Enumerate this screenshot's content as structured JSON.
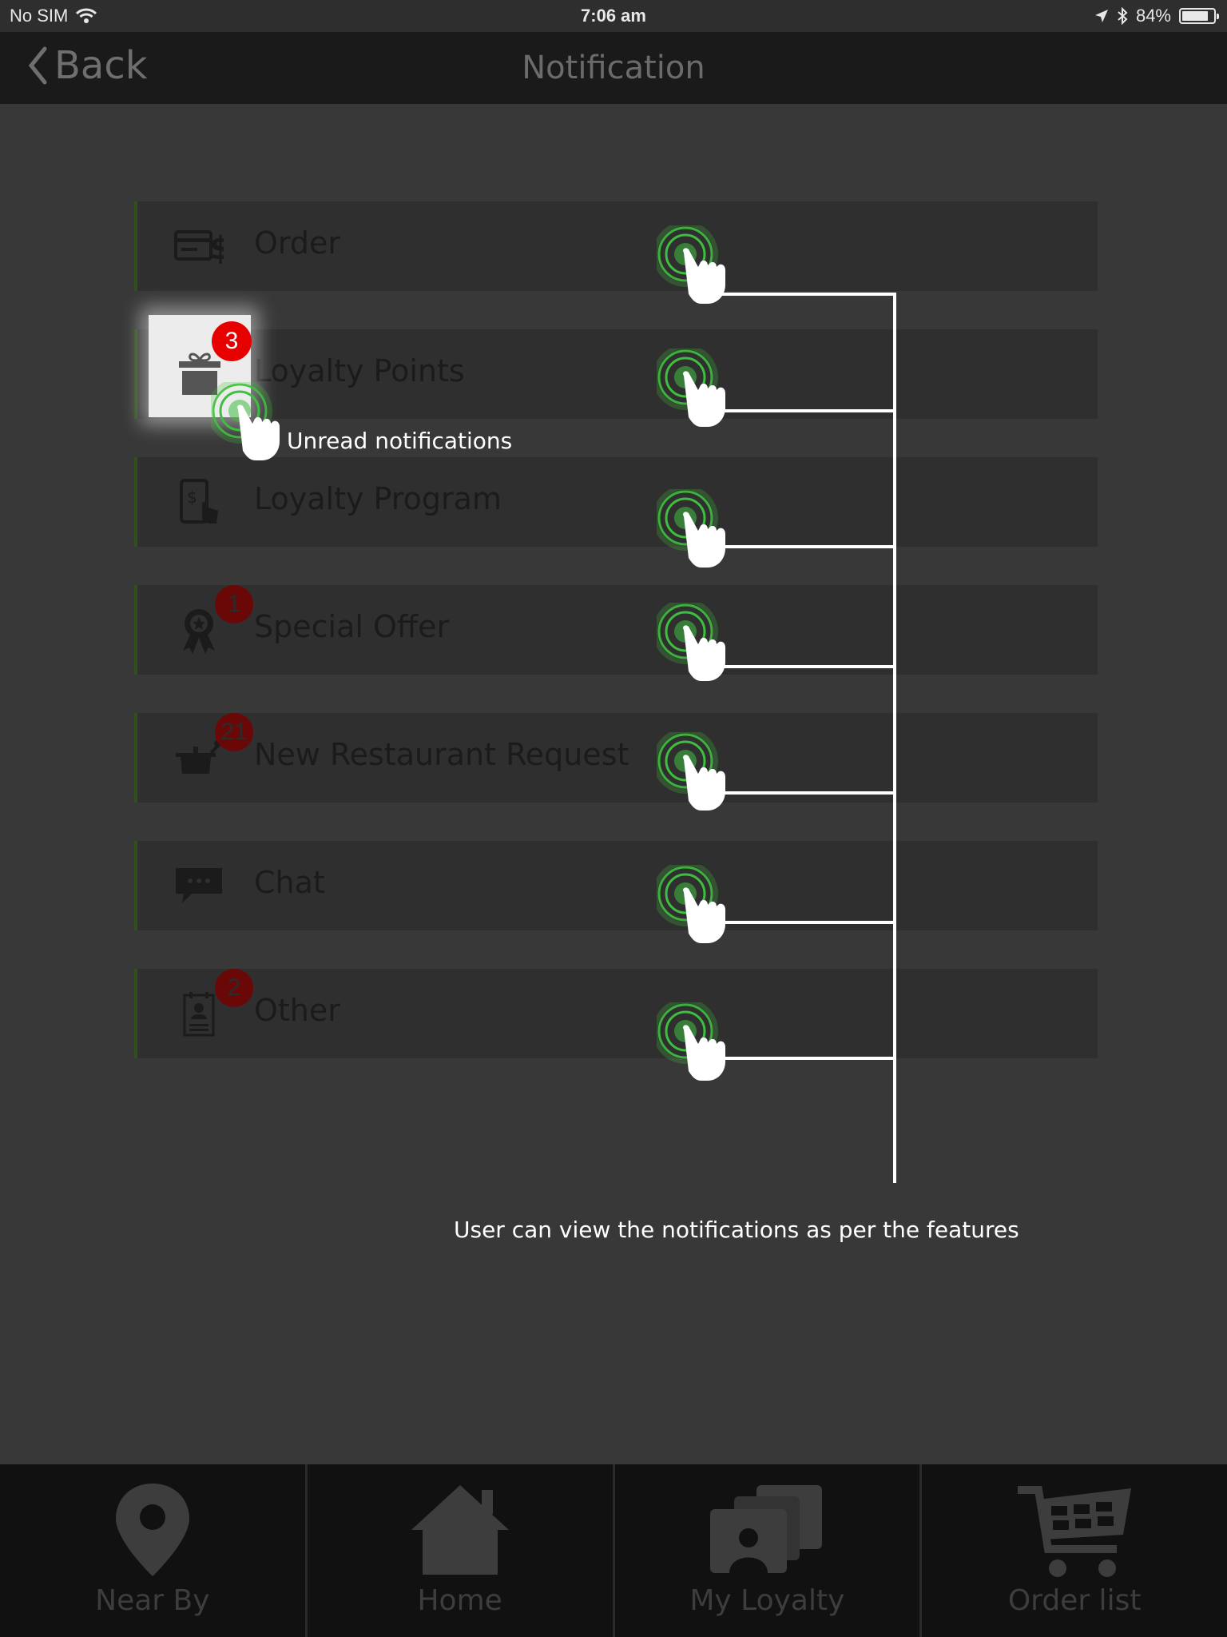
{
  "status_bar": {
    "carrier": "No SIM",
    "time": "7:06 am",
    "battery": "84%",
    "battery_level": 0.84
  },
  "nav": {
    "back_label": "Back",
    "title": "Notification"
  },
  "rows": [
    {
      "label": "Order",
      "icon": "order-icon",
      "badge": null
    },
    {
      "label": "Loyalty Points",
      "icon": "gift-icon",
      "badge": "3"
    },
    {
      "label": "Loyalty Program",
      "icon": "loyalty-program-icon",
      "badge": null
    },
    {
      "label": "Special Offer",
      "icon": "award-icon",
      "badge": "1"
    },
    {
      "label": "New Restaurant Request",
      "icon": "cooking-pot-icon",
      "badge": "21"
    },
    {
      "label": "Chat",
      "icon": "chat-icon",
      "badge": null
    },
    {
      "label": "Other",
      "icon": "contact-card-icon",
      "badge": "2"
    }
  ],
  "annotations": {
    "unread": "Unread notifications",
    "summary": "User can view the notifications as per the features"
  },
  "tabs": [
    {
      "label": "Near By",
      "icon": "map-pin-icon"
    },
    {
      "label": "Home",
      "icon": "home-icon"
    },
    {
      "label": "My Loyalty",
      "icon": "loyalty-cards-icon"
    },
    {
      "label": "Order list",
      "icon": "cart-icon"
    }
  ],
  "colors": {
    "tap_ring": "#3fbf3f",
    "badge_red": "#e60000",
    "accent_green": "#2f4f1c"
  }
}
